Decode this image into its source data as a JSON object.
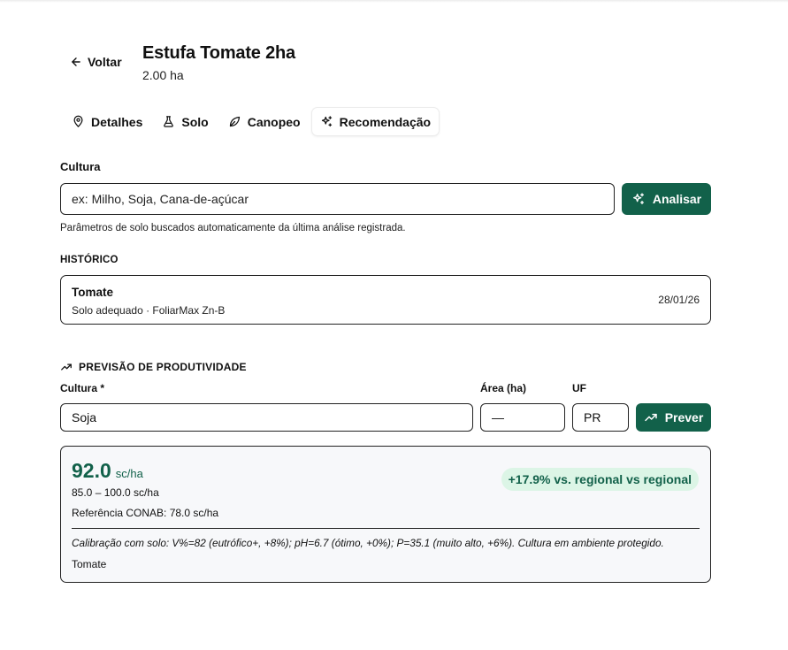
{
  "header": {
    "back_label": "Voltar",
    "title": "Estufa Tomate 2ha",
    "area": "2.00 ha"
  },
  "tabs": [
    {
      "label": "Detalhes",
      "icon": "map-pin-icon",
      "active": false
    },
    {
      "label": "Solo",
      "icon": "flask-icon",
      "active": false
    },
    {
      "label": "Canopeo",
      "icon": "leaf-icon",
      "active": false
    },
    {
      "label": "Recomendação",
      "icon": "sparkles-icon",
      "active": true
    }
  ],
  "cultura": {
    "label": "Cultura",
    "placeholder": "ex: Milho, Soja, Cana-de-açúcar",
    "analyze_button": "Analisar",
    "hint": "Parâmetros de solo buscados automaticamente da última análise registrada."
  },
  "historico": {
    "title": "HISTÓRICO",
    "items": [
      {
        "crop": "Tomate",
        "description": "Solo adequado · FoliarMax Zn-B",
        "date": "28/01/26"
      }
    ]
  },
  "previsao": {
    "title": "PREVISÃO DE PRODUTIVIDADE",
    "crop_label": "Cultura *",
    "crop_value": "Soja",
    "area_label": "Área (ha)",
    "area_value": "—",
    "uf_label": "UF",
    "uf_value": "PR",
    "predict_button": "Prever"
  },
  "resultado": {
    "yield_value": "92.0",
    "yield_unit": "sc/ha",
    "range": "85.0 – 100.0 sc/ha",
    "reference": "Referência CONAB: 78.0 sc/ha",
    "badge": "+17.9% vs. regional vs regional",
    "calibration": "Calibração com solo: V%=82 (eutrófico+, +8%); pH=6.7 (ótimo, +0%); P=35.1 (muito alto, +6%). Cultura em ambiente protegido.",
    "crop": "Tomate"
  },
  "colors": {
    "accent": "#12614a",
    "badge_bg": "#dcf5e6",
    "card_bg": "#f7f8fa"
  }
}
